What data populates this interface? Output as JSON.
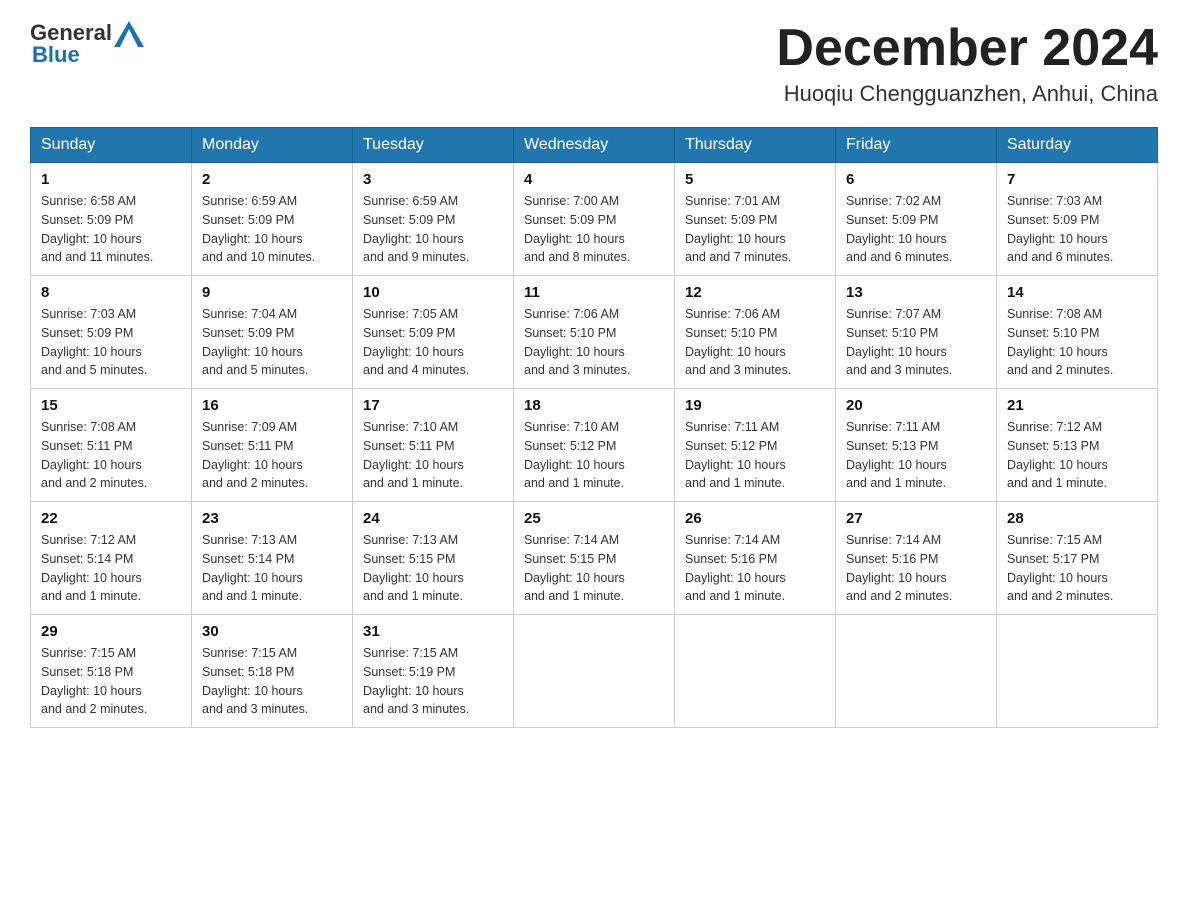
{
  "header": {
    "logo_general": "General",
    "logo_blue": "Blue",
    "month_title": "December 2024",
    "location": "Huoqiu Chengguanzhen, Anhui, China"
  },
  "weekdays": [
    "Sunday",
    "Monday",
    "Tuesday",
    "Wednesday",
    "Thursday",
    "Friday",
    "Saturday"
  ],
  "weeks": [
    [
      {
        "day": "1",
        "sunrise": "6:58 AM",
        "sunset": "5:09 PM",
        "daylight": "10 hours and 11 minutes."
      },
      {
        "day": "2",
        "sunrise": "6:59 AM",
        "sunset": "5:09 PM",
        "daylight": "10 hours and 10 minutes."
      },
      {
        "day": "3",
        "sunrise": "6:59 AM",
        "sunset": "5:09 PM",
        "daylight": "10 hours and 9 minutes."
      },
      {
        "day": "4",
        "sunrise": "7:00 AM",
        "sunset": "5:09 PM",
        "daylight": "10 hours and 8 minutes."
      },
      {
        "day": "5",
        "sunrise": "7:01 AM",
        "sunset": "5:09 PM",
        "daylight": "10 hours and 7 minutes."
      },
      {
        "day": "6",
        "sunrise": "7:02 AM",
        "sunset": "5:09 PM",
        "daylight": "10 hours and 6 minutes."
      },
      {
        "day": "7",
        "sunrise": "7:03 AM",
        "sunset": "5:09 PM",
        "daylight": "10 hours and 6 minutes."
      }
    ],
    [
      {
        "day": "8",
        "sunrise": "7:03 AM",
        "sunset": "5:09 PM",
        "daylight": "10 hours and 5 minutes."
      },
      {
        "day": "9",
        "sunrise": "7:04 AM",
        "sunset": "5:09 PM",
        "daylight": "10 hours and 5 minutes."
      },
      {
        "day": "10",
        "sunrise": "7:05 AM",
        "sunset": "5:09 PM",
        "daylight": "10 hours and 4 minutes."
      },
      {
        "day": "11",
        "sunrise": "7:06 AM",
        "sunset": "5:10 PM",
        "daylight": "10 hours and 3 minutes."
      },
      {
        "day": "12",
        "sunrise": "7:06 AM",
        "sunset": "5:10 PM",
        "daylight": "10 hours and 3 minutes."
      },
      {
        "day": "13",
        "sunrise": "7:07 AM",
        "sunset": "5:10 PM",
        "daylight": "10 hours and 3 minutes."
      },
      {
        "day": "14",
        "sunrise": "7:08 AM",
        "sunset": "5:10 PM",
        "daylight": "10 hours and 2 minutes."
      }
    ],
    [
      {
        "day": "15",
        "sunrise": "7:08 AM",
        "sunset": "5:11 PM",
        "daylight": "10 hours and 2 minutes."
      },
      {
        "day": "16",
        "sunrise": "7:09 AM",
        "sunset": "5:11 PM",
        "daylight": "10 hours and 2 minutes."
      },
      {
        "day": "17",
        "sunrise": "7:10 AM",
        "sunset": "5:11 PM",
        "daylight": "10 hours and 1 minute."
      },
      {
        "day": "18",
        "sunrise": "7:10 AM",
        "sunset": "5:12 PM",
        "daylight": "10 hours and 1 minute."
      },
      {
        "day": "19",
        "sunrise": "7:11 AM",
        "sunset": "5:12 PM",
        "daylight": "10 hours and 1 minute."
      },
      {
        "day": "20",
        "sunrise": "7:11 AM",
        "sunset": "5:13 PM",
        "daylight": "10 hours and 1 minute."
      },
      {
        "day": "21",
        "sunrise": "7:12 AM",
        "sunset": "5:13 PM",
        "daylight": "10 hours and 1 minute."
      }
    ],
    [
      {
        "day": "22",
        "sunrise": "7:12 AM",
        "sunset": "5:14 PM",
        "daylight": "10 hours and 1 minute."
      },
      {
        "day": "23",
        "sunrise": "7:13 AM",
        "sunset": "5:14 PM",
        "daylight": "10 hours and 1 minute."
      },
      {
        "day": "24",
        "sunrise": "7:13 AM",
        "sunset": "5:15 PM",
        "daylight": "10 hours and 1 minute."
      },
      {
        "day": "25",
        "sunrise": "7:14 AM",
        "sunset": "5:15 PM",
        "daylight": "10 hours and 1 minute."
      },
      {
        "day": "26",
        "sunrise": "7:14 AM",
        "sunset": "5:16 PM",
        "daylight": "10 hours and 1 minute."
      },
      {
        "day": "27",
        "sunrise": "7:14 AM",
        "sunset": "5:16 PM",
        "daylight": "10 hours and 2 minutes."
      },
      {
        "day": "28",
        "sunrise": "7:15 AM",
        "sunset": "5:17 PM",
        "daylight": "10 hours and 2 minutes."
      }
    ],
    [
      {
        "day": "29",
        "sunrise": "7:15 AM",
        "sunset": "5:18 PM",
        "daylight": "10 hours and 2 minutes."
      },
      {
        "day": "30",
        "sunrise": "7:15 AM",
        "sunset": "5:18 PM",
        "daylight": "10 hours and 3 minutes."
      },
      {
        "day": "31",
        "sunrise": "7:15 AM",
        "sunset": "5:19 PM",
        "daylight": "10 hours and 3 minutes."
      },
      null,
      null,
      null,
      null
    ]
  ],
  "labels": {
    "sunrise": "Sunrise:",
    "sunset": "Sunset:",
    "daylight": "Daylight:"
  }
}
